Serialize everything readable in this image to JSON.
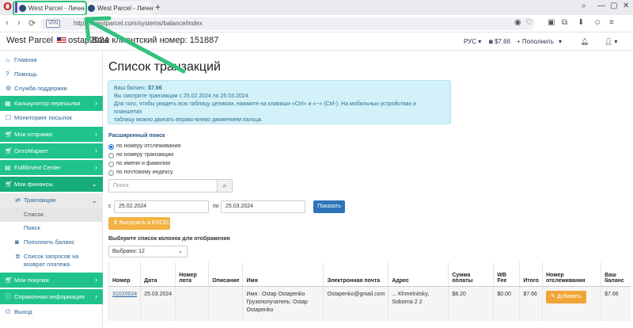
{
  "browser": {
    "tabs": [
      {
        "title": "West Parcel - Личный кабинет"
      },
      {
        "title": "West Parcel - Личный кабинет"
      }
    ],
    "url": "https://westparcel.com/systems/balance/index",
    "vpn": "VPN"
  },
  "header": {
    "brand": "West Parcel",
    "username": "ostap2024",
    "client_number": "Ваш клиентский номер: 151887",
    "lang": "РУС",
    "balance": "$7.66",
    "topup": "Пополнить"
  },
  "sidebar": {
    "links_top": [
      "Главная",
      "Помощь",
      "Служба поддержки"
    ],
    "groups": [
      "Калькулятор пересылки",
      "Мои отправки",
      "ОптоМаркет",
      "Fulfillment Center",
      "Мои финансы",
      "Мои покупки",
      "Справочная информация"
    ],
    "monitoring": "Мониторинг посылок",
    "transactions": "Транзакции",
    "subs": [
      "Список",
      "Поиск",
      "Пополнить баланс",
      "Список запросов на возврат платежа"
    ],
    "logout": "Выход"
  },
  "main": {
    "title": "Список транзакций",
    "info": {
      "balance_prefix": "Ваш баланс: ",
      "balance": "$7.66",
      "line2": "Вы смотрите транзакции с 25.02.2024 по 25.03.2024.",
      "line3": "Для того, чтобы увидеть всю таблицу целиком, нажмите на клавиши «Ctrl» и «−» (Ctrl-). На мобильных устройствах и планшетах",
      "line4": "таблицу можно двигать вправо-влево движением пальца."
    },
    "adv_search": "Расширенный поиск",
    "radios": [
      "по номеру отслеживания",
      "по номеру транзакции",
      "по имени и фамилии",
      "по почтовому индексу"
    ],
    "search_placeholder": "Поиск",
    "from_label": "с",
    "to_label": "по",
    "date_from": "25.02.2024",
    "date_to": "25.03.2024",
    "show_button": "Показать",
    "excel_button": "Выгрузить в EXCEL",
    "columns_label": "Выберите список колонок для отображения",
    "selected": "Выбрано: 12",
    "table": {
      "headers": [
        "Номер",
        "Дата",
        "Номер лота",
        "Описание",
        "Имя",
        "Электронная почта",
        "Адрес",
        "Сумма оплаты",
        "WB Fee",
        "Итого",
        "Номер отслеживания",
        "Ваш баланс"
      ],
      "row": {
        "number": "31020024",
        "date": "25.03.2024",
        "lot": "",
        "description": "",
        "name": "Имя : Ostap Ostapenko Грузополучатель: Ostap Ostapenko",
        "email": "Ostapenko@gmail.com",
        "address": "... Khmelnitsky, Soborna 2 2",
        "payment": "$8.20",
        "fee": "$0.00",
        "total": "$7.66",
        "add_button": "Добавить",
        "balance": "$7.66"
      }
    }
  }
}
